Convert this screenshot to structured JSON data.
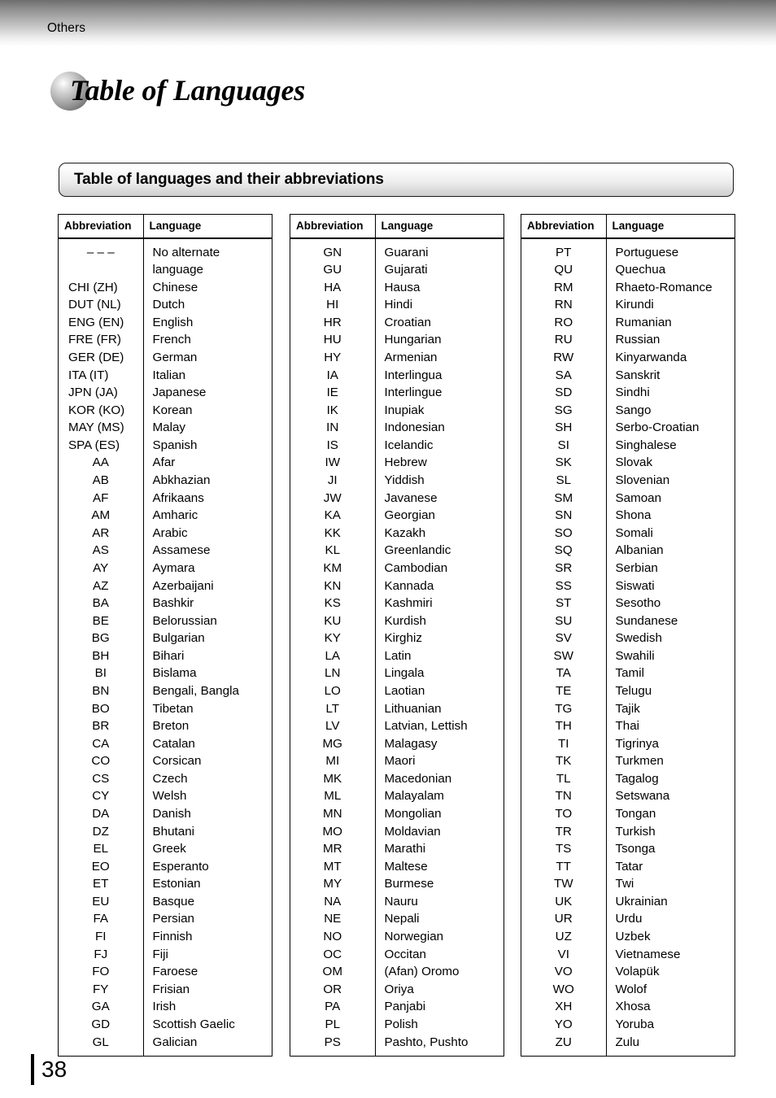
{
  "header": {
    "running_head": "Others",
    "chapter_title": "Table of Languages",
    "sphere_icon": "gradient-sphere-bullet"
  },
  "section": {
    "banner_title": "Table of languages and their abbreviations"
  },
  "table_headers": {
    "abbreviation": "Abbreviation",
    "language": "Language"
  },
  "columns": [
    {
      "id": "column-1",
      "rows": [
        {
          "abbr": "– – –",
          "lang": "No alternate",
          "lang2": "language",
          "align": "center"
        },
        {
          "abbr": "CHI (ZH)",
          "lang": "Chinese",
          "align": "left"
        },
        {
          "abbr": "DUT (NL)",
          "lang": "Dutch",
          "align": "left"
        },
        {
          "abbr": "ENG (EN)",
          "lang": "English",
          "align": "left"
        },
        {
          "abbr": "FRE (FR)",
          "lang": "French",
          "align": "left"
        },
        {
          "abbr": "GER (DE)",
          "lang": "German",
          "align": "left"
        },
        {
          "abbr": "ITA (IT)",
          "lang": "Italian",
          "align": "left"
        },
        {
          "abbr": "JPN (JA)",
          "lang": "Japanese",
          "align": "left"
        },
        {
          "abbr": "KOR (KO)",
          "lang": "Korean",
          "align": "left"
        },
        {
          "abbr": "MAY (MS)",
          "lang": "Malay",
          "align": "left"
        },
        {
          "abbr": "SPA (ES)",
          "lang": "Spanish",
          "align": "left"
        },
        {
          "abbr": "AA",
          "lang": "Afar",
          "align": "center"
        },
        {
          "abbr": "AB",
          "lang": "Abkhazian",
          "align": "center"
        },
        {
          "abbr": "AF",
          "lang": "Afrikaans",
          "align": "center"
        },
        {
          "abbr": "AM",
          "lang": "Amharic",
          "align": "center"
        },
        {
          "abbr": "AR",
          "lang": "Arabic",
          "align": "center"
        },
        {
          "abbr": "AS",
          "lang": "Assamese",
          "align": "center"
        },
        {
          "abbr": "AY",
          "lang": "Aymara",
          "align": "center"
        },
        {
          "abbr": "AZ",
          "lang": "Azerbaijani",
          "align": "center"
        },
        {
          "abbr": "BA",
          "lang": "Bashkir",
          "align": "center"
        },
        {
          "abbr": "BE",
          "lang": "Belorussian",
          "align": "center"
        },
        {
          "abbr": "BG",
          "lang": "Bulgarian",
          "align": "center"
        },
        {
          "abbr": "BH",
          "lang": "Bihari",
          "align": "center"
        },
        {
          "abbr": "BI",
          "lang": "Bislama",
          "align": "center"
        },
        {
          "abbr": "BN",
          "lang": "Bengali, Bangla",
          "align": "center"
        },
        {
          "abbr": "BO",
          "lang": "Tibetan",
          "align": "center"
        },
        {
          "abbr": "BR",
          "lang": "Breton",
          "align": "center"
        },
        {
          "abbr": "CA",
          "lang": "Catalan",
          "align": "center"
        },
        {
          "abbr": "CO",
          "lang": "Corsican",
          "align": "center"
        },
        {
          "abbr": "CS",
          "lang": "Czech",
          "align": "center"
        },
        {
          "abbr": "CY",
          "lang": "Welsh",
          "align": "center"
        },
        {
          "abbr": "DA",
          "lang": "Danish",
          "align": "center"
        },
        {
          "abbr": "DZ",
          "lang": "Bhutani",
          "align": "center"
        },
        {
          "abbr": "EL",
          "lang": "Greek",
          "align": "center"
        },
        {
          "abbr": "EO",
          "lang": "Esperanto",
          "align": "center"
        },
        {
          "abbr": "ET",
          "lang": "Estonian",
          "align": "center"
        },
        {
          "abbr": "EU",
          "lang": "Basque",
          "align": "center"
        },
        {
          "abbr": "FA",
          "lang": "Persian",
          "align": "center"
        },
        {
          "abbr": "FI",
          "lang": "Finnish",
          "align": "center"
        },
        {
          "abbr": "FJ",
          "lang": "Fiji",
          "align": "center"
        },
        {
          "abbr": "FO",
          "lang": "Faroese",
          "align": "center"
        },
        {
          "abbr": "FY",
          "lang": "Frisian",
          "align": "center"
        },
        {
          "abbr": "GA",
          "lang": "Irish",
          "align": "center"
        },
        {
          "abbr": "GD",
          "lang": "Scottish Gaelic",
          "align": "center"
        },
        {
          "abbr": "GL",
          "lang": "Galician",
          "align": "center"
        }
      ]
    },
    {
      "id": "column-2",
      "rows": [
        {
          "abbr": "GN",
          "lang": "Guarani",
          "align": "center"
        },
        {
          "abbr": "GU",
          "lang": "Gujarati",
          "align": "center"
        },
        {
          "abbr": "HA",
          "lang": "Hausa",
          "align": "center"
        },
        {
          "abbr": "HI",
          "lang": "Hindi",
          "align": "center"
        },
        {
          "abbr": "HR",
          "lang": "Croatian",
          "align": "center"
        },
        {
          "abbr": "HU",
          "lang": "Hungarian",
          "align": "center"
        },
        {
          "abbr": "HY",
          "lang": "Armenian",
          "align": "center"
        },
        {
          "abbr": "IA",
          "lang": "Interlingua",
          "align": "center"
        },
        {
          "abbr": "IE",
          "lang": "Interlingue",
          "align": "center"
        },
        {
          "abbr": "IK",
          "lang": "Inupiak",
          "align": "center"
        },
        {
          "abbr": "IN",
          "lang": "Indonesian",
          "align": "center"
        },
        {
          "abbr": "IS",
          "lang": "Icelandic",
          "align": "center"
        },
        {
          "abbr": "IW",
          "lang": "Hebrew",
          "align": "center"
        },
        {
          "abbr": "JI",
          "lang": "Yiddish",
          "align": "center"
        },
        {
          "abbr": "JW",
          "lang": "Javanese",
          "align": "center"
        },
        {
          "abbr": "KA",
          "lang": "Georgian",
          "align": "center"
        },
        {
          "abbr": "KK",
          "lang": "Kazakh",
          "align": "center"
        },
        {
          "abbr": "KL",
          "lang": "Greenlandic",
          "align": "center"
        },
        {
          "abbr": "KM",
          "lang": "Cambodian",
          "align": "center"
        },
        {
          "abbr": "KN",
          "lang": "Kannada",
          "align": "center"
        },
        {
          "abbr": "KS",
          "lang": "Kashmiri",
          "align": "center"
        },
        {
          "abbr": "KU",
          "lang": "Kurdish",
          "align": "center"
        },
        {
          "abbr": "KY",
          "lang": "Kirghiz",
          "align": "center"
        },
        {
          "abbr": "LA",
          "lang": "Latin",
          "align": "center"
        },
        {
          "abbr": "LN",
          "lang": "Lingala",
          "align": "center"
        },
        {
          "abbr": "LO",
          "lang": "Laotian",
          "align": "center"
        },
        {
          "abbr": "LT",
          "lang": "Lithuanian",
          "align": "center"
        },
        {
          "abbr": "LV",
          "lang": "Latvian, Lettish",
          "align": "center"
        },
        {
          "abbr": "MG",
          "lang": "Malagasy",
          "align": "center"
        },
        {
          "abbr": "MI",
          "lang": "Maori",
          "align": "center"
        },
        {
          "abbr": "MK",
          "lang": "Macedonian",
          "align": "center"
        },
        {
          "abbr": "ML",
          "lang": "Malayalam",
          "align": "center"
        },
        {
          "abbr": "MN",
          "lang": "Mongolian",
          "align": "center"
        },
        {
          "abbr": "MO",
          "lang": "Moldavian",
          "align": "center"
        },
        {
          "abbr": "MR",
          "lang": "Marathi",
          "align": "center"
        },
        {
          "abbr": "MT",
          "lang": "Maltese",
          "align": "center"
        },
        {
          "abbr": "MY",
          "lang": "Burmese",
          "align": "center"
        },
        {
          "abbr": "NA",
          "lang": "Nauru",
          "align": "center"
        },
        {
          "abbr": "NE",
          "lang": "Nepali",
          "align": "center"
        },
        {
          "abbr": "NO",
          "lang": "Norwegian",
          "align": "center"
        },
        {
          "abbr": "OC",
          "lang": "Occitan",
          "align": "center"
        },
        {
          "abbr": "OM",
          "lang": "(Afan) Oromo",
          "align": "center"
        },
        {
          "abbr": "OR",
          "lang": "Oriya",
          "align": "center"
        },
        {
          "abbr": "PA",
          "lang": "Panjabi",
          "align": "center"
        },
        {
          "abbr": "PL",
          "lang": "Polish",
          "align": "center"
        },
        {
          "abbr": "PS",
          "lang": "Pashto, Pushto",
          "align": "center"
        }
      ]
    },
    {
      "id": "column-3",
      "rows": [
        {
          "abbr": "PT",
          "lang": "Portuguese",
          "align": "center"
        },
        {
          "abbr": "QU",
          "lang": "Quechua",
          "align": "center"
        },
        {
          "abbr": "RM",
          "lang": "Rhaeto-Romance",
          "align": "center"
        },
        {
          "abbr": "RN",
          "lang": "Kirundi",
          "align": "center"
        },
        {
          "abbr": "RO",
          "lang": "Rumanian",
          "align": "center"
        },
        {
          "abbr": "RU",
          "lang": "Russian",
          "align": "center"
        },
        {
          "abbr": "RW",
          "lang": "Kinyarwanda",
          "align": "center"
        },
        {
          "abbr": "SA",
          "lang": "Sanskrit",
          "align": "center"
        },
        {
          "abbr": "SD",
          "lang": "Sindhi",
          "align": "center"
        },
        {
          "abbr": "SG",
          "lang": "Sango",
          "align": "center"
        },
        {
          "abbr": "SH",
          "lang": "Serbo-Croatian",
          "align": "center"
        },
        {
          "abbr": "SI",
          "lang": "Singhalese",
          "align": "center"
        },
        {
          "abbr": "SK",
          "lang": "Slovak",
          "align": "center"
        },
        {
          "abbr": "SL",
          "lang": "Slovenian",
          "align": "center"
        },
        {
          "abbr": "SM",
          "lang": "Samoan",
          "align": "center"
        },
        {
          "abbr": "SN",
          "lang": "Shona",
          "align": "center"
        },
        {
          "abbr": "SO",
          "lang": "Somali",
          "align": "center"
        },
        {
          "abbr": "SQ",
          "lang": "Albanian",
          "align": "center"
        },
        {
          "abbr": "SR",
          "lang": "Serbian",
          "align": "center"
        },
        {
          "abbr": "SS",
          "lang": "Siswati",
          "align": "center"
        },
        {
          "abbr": "ST",
          "lang": "Sesotho",
          "align": "center"
        },
        {
          "abbr": "SU",
          "lang": "Sundanese",
          "align": "center"
        },
        {
          "abbr": "SV",
          "lang": "Swedish",
          "align": "center"
        },
        {
          "abbr": "SW",
          "lang": "Swahili",
          "align": "center"
        },
        {
          "abbr": "TA",
          "lang": "Tamil",
          "align": "center"
        },
        {
          "abbr": "TE",
          "lang": "Telugu",
          "align": "center"
        },
        {
          "abbr": "TG",
          "lang": "Tajik",
          "align": "center"
        },
        {
          "abbr": "TH",
          "lang": "Thai",
          "align": "center"
        },
        {
          "abbr": "TI",
          "lang": "Tigrinya",
          "align": "center"
        },
        {
          "abbr": "TK",
          "lang": "Turkmen",
          "align": "center"
        },
        {
          "abbr": "TL",
          "lang": "Tagalog",
          "align": "center"
        },
        {
          "abbr": "TN",
          "lang": "Setswana",
          "align": "center"
        },
        {
          "abbr": "TO",
          "lang": "Tongan",
          "align": "center"
        },
        {
          "abbr": "TR",
          "lang": "Turkish",
          "align": "center"
        },
        {
          "abbr": "TS",
          "lang": "Tsonga",
          "align": "center"
        },
        {
          "abbr": "TT",
          "lang": "Tatar",
          "align": "center"
        },
        {
          "abbr": "TW",
          "lang": "Twi",
          "align": "center"
        },
        {
          "abbr": "UK",
          "lang": "Ukrainian",
          "align": "center"
        },
        {
          "abbr": "UR",
          "lang": "Urdu",
          "align": "center"
        },
        {
          "abbr": "UZ",
          "lang": "Uzbek",
          "align": "center"
        },
        {
          "abbr": "VI",
          "lang": "Vietnamese",
          "align": "center"
        },
        {
          "abbr": "VO",
          "lang": "Volapük",
          "align": "center"
        },
        {
          "abbr": "WO",
          "lang": "Wolof",
          "align": "center"
        },
        {
          "abbr": "XH",
          "lang": "Xhosa",
          "align": "center"
        },
        {
          "abbr": "YO",
          "lang": "Yoruba",
          "align": "center"
        },
        {
          "abbr": "ZU",
          "lang": "Zulu",
          "align": "center"
        }
      ]
    }
  ],
  "footer": {
    "page_number": "38"
  }
}
